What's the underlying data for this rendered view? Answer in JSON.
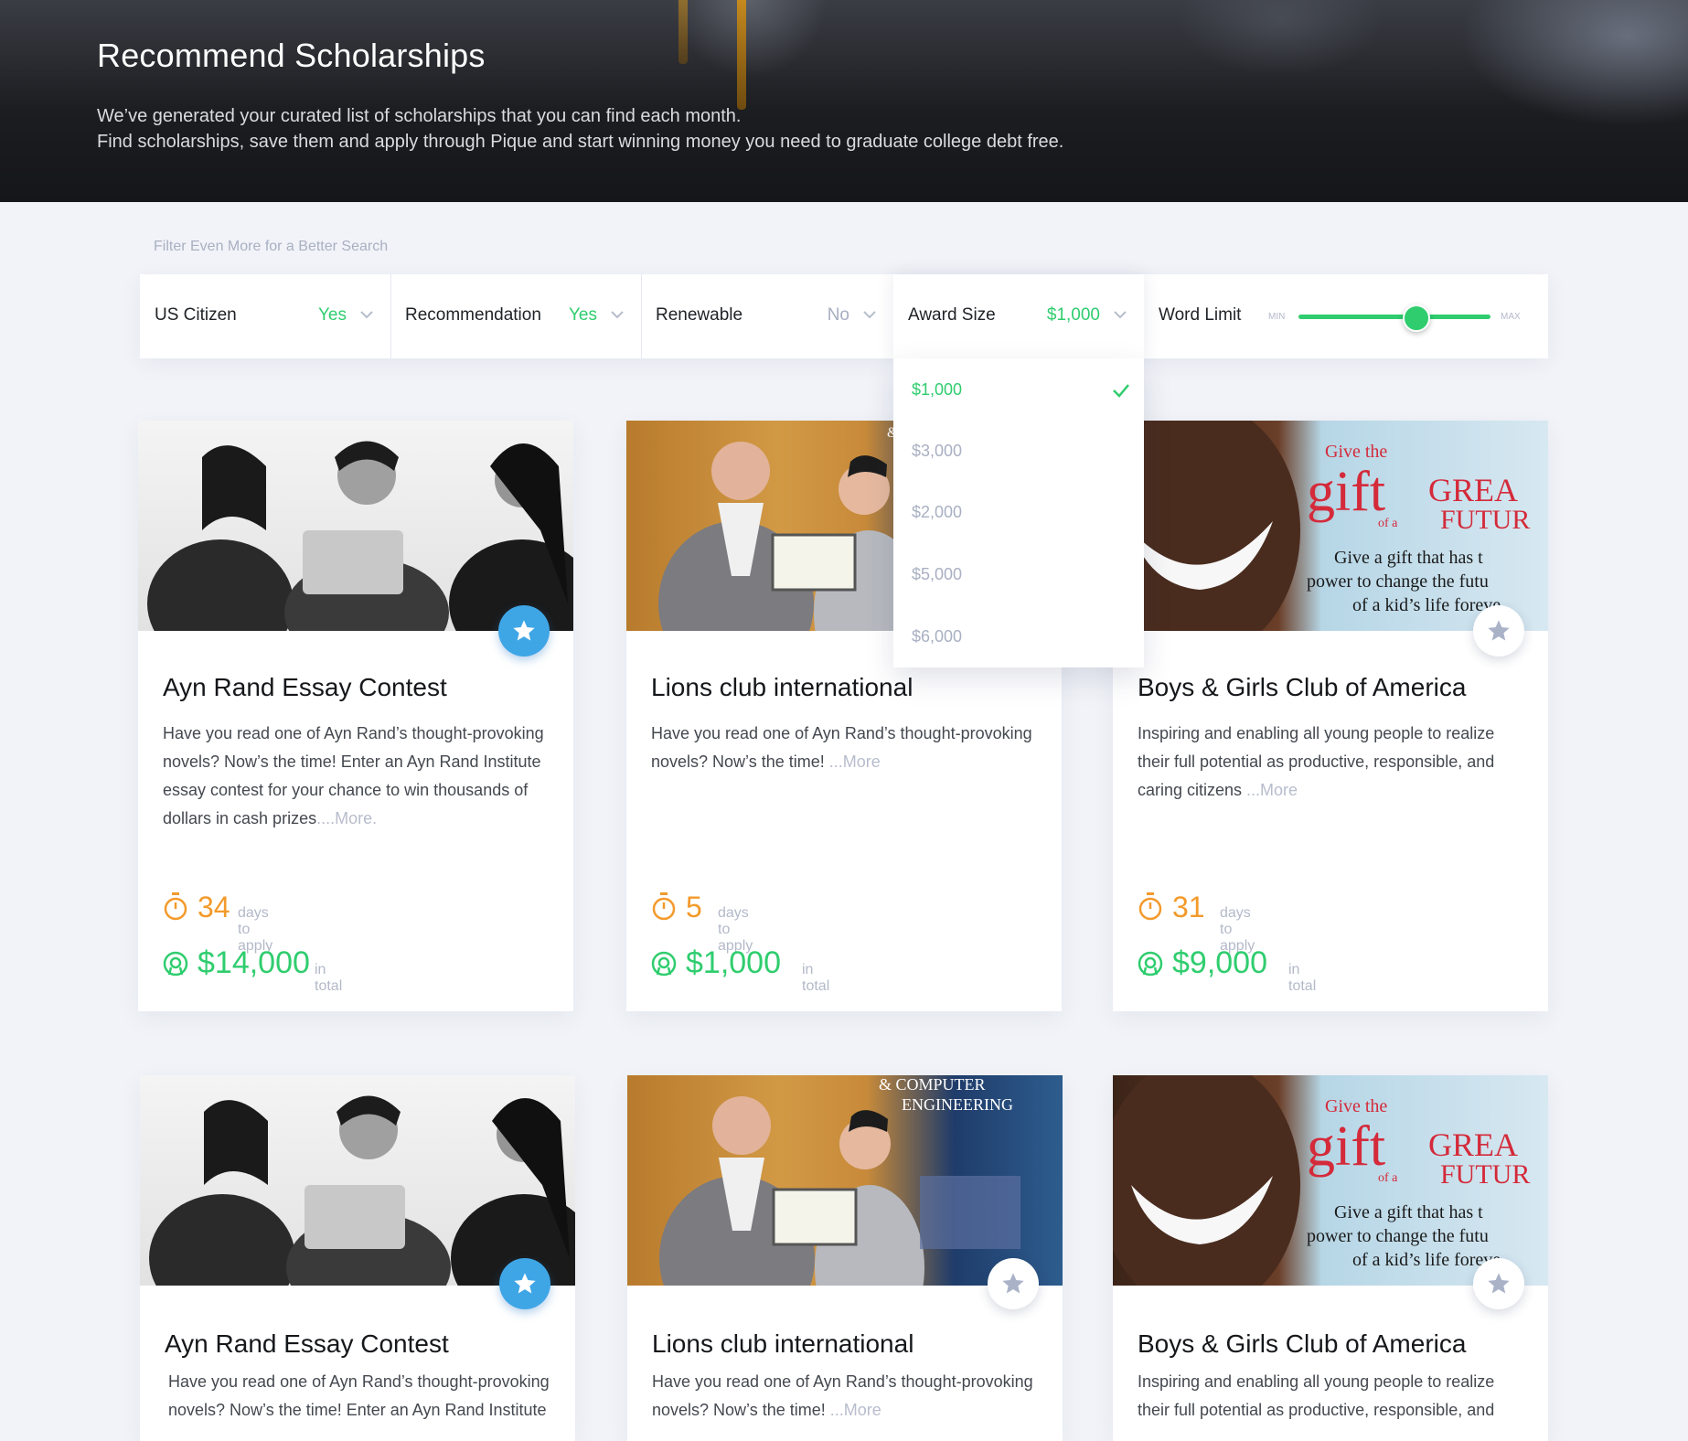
{
  "hero": {
    "title": "Recommend Scholarships",
    "line1": "We’ve generated your curated list of scholarships that you can find each month.",
    "line2": "Find scholarships, save them and apply through Pique and start winning money you need to graduate college debt free."
  },
  "filters": {
    "hint": "Filter Even More for a Better Search",
    "items": [
      {
        "label": "US Citizen",
        "value": "Yes"
      },
      {
        "label": "Recommendation",
        "value": "Yes"
      },
      {
        "label": "Renewable",
        "value": "No"
      },
      {
        "label": "Award Size",
        "value": "$1,000"
      },
      {
        "label": "Word Limit"
      }
    ],
    "slider": {
      "min_label": "MIN",
      "max_label": "MAX",
      "level": 0.6
    },
    "award_options": [
      "$1,000",
      "$3,000",
      "$2,000",
      "$5,000",
      "$6,000"
    ],
    "award_selected": "$1,000"
  },
  "colors": {
    "green": "#2fcd6e",
    "orange": "#f39a2b",
    "blue": "#3fa6e6",
    "muted": "#b3b9c9"
  },
  "icons": {
    "star": "star-icon",
    "timer": "stopwatch-icon",
    "award": "award-ribbon-icon",
    "chevron": "chevron-down-icon",
    "check": "check-icon"
  },
  "labels": {
    "days": "days to apply",
    "total": "in total"
  },
  "images": {
    "lions_banner": [
      "&",
      "& COMPUTER",
      "ENGINEERING"
    ],
    "kids_banner": [
      "Give the",
      "gift",
      "of a",
      "GREA",
      "FUTUR",
      "Give a gift that has t",
      "power to change the futu",
      "of a kid’s life foreve"
    ]
  },
  "cards": [
    {
      "title": "Ayn Rand Essay Contest",
      "desc": "Have you read one of Ayn Rand’s thought-provoking novels? Now’s the time! Enter an Ayn Rand Institute essay contest for your chance to win thousands of dollars in cash prizes",
      "more": "....More.",
      "days": "34",
      "amount": "$14,000",
      "starred": true
    },
    {
      "title": "Lions club international",
      "desc": "Have you read one of Ayn Rand’s thought-provoking novels? Now’s the time!",
      "more": " ...More",
      "days": "5",
      "amount": "$1,000",
      "starred": false
    },
    {
      "title": "Boys & Girls Club of America",
      "desc": "Inspiring and enabling all young people to realize their full potential as productive, responsible, and caring citizens",
      "more": " ...More",
      "days": "31",
      "amount": "$9,000",
      "starred": false
    },
    {
      "title": "Ayn Rand Essay Contest",
      "desc": "Have you read one of Ayn Rand’s thought-provoking novels? Now’s the time! Enter an Ayn Rand Institute",
      "starred": true
    },
    {
      "title": "Lions club international",
      "desc": "Have you read one of Ayn Rand’s thought-provoking novels? Now’s the time!",
      "more": " ...More",
      "starred": false
    },
    {
      "title": "Boys & Girls Club of America",
      "desc": "Inspiring and enabling all young people to realize their full potential as productive, responsible, and",
      "starred": false
    }
  ]
}
